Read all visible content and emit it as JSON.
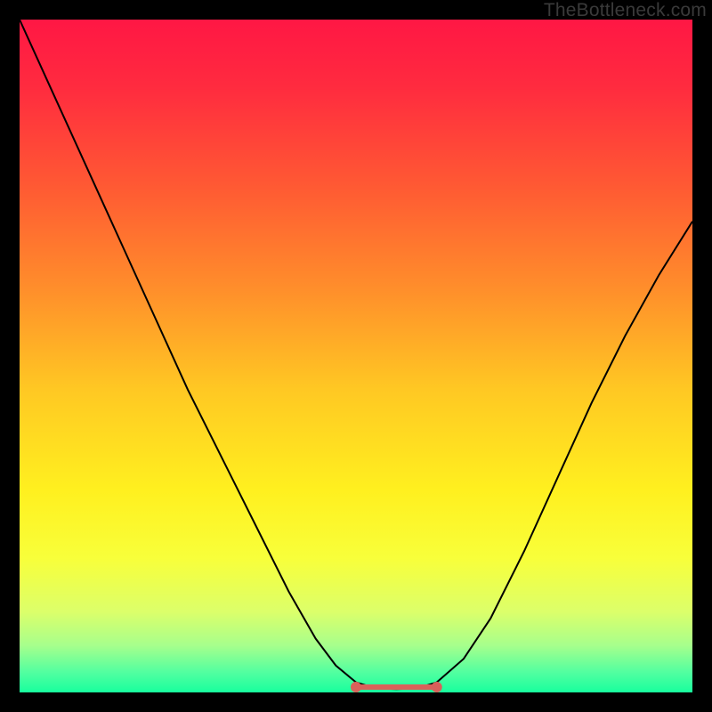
{
  "watermark": "TheBottleneck.com",
  "chart_data": {
    "type": "line",
    "title": "",
    "xlabel": "",
    "ylabel": "",
    "xlim": [
      0,
      100
    ],
    "ylim": [
      0,
      100
    ],
    "grid": false,
    "legend": false,
    "background_gradient": {
      "stops": [
        {
          "offset": 0.0,
          "color": "#ff1744"
        },
        {
          "offset": 0.1,
          "color": "#ff2b3f"
        },
        {
          "offset": 0.25,
          "color": "#ff5a33"
        },
        {
          "offset": 0.4,
          "color": "#ff8e2b"
        },
        {
          "offset": 0.55,
          "color": "#ffc823"
        },
        {
          "offset": 0.7,
          "color": "#fff01f"
        },
        {
          "offset": 0.8,
          "color": "#f8ff3a"
        },
        {
          "offset": 0.88,
          "color": "#dcff6a"
        },
        {
          "offset": 0.93,
          "color": "#a7ff8c"
        },
        {
          "offset": 0.97,
          "color": "#52ffa0"
        },
        {
          "offset": 1.0,
          "color": "#18ff9e"
        }
      ]
    },
    "series": [
      {
        "name": "bottleneck-curve",
        "color": "#000000",
        "x": [
          0,
          5,
          10,
          15,
          20,
          25,
          30,
          35,
          40,
          44,
          47,
          50,
          53,
          56,
          59,
          62,
          66,
          70,
          75,
          80,
          85,
          90,
          95,
          100
        ],
        "values": [
          100,
          89,
          78,
          67,
          56,
          45,
          35,
          25,
          15,
          8,
          4,
          1.5,
          0.6,
          0.5,
          0.6,
          1.5,
          5,
          11,
          21,
          32,
          43,
          53,
          62,
          70
        ]
      }
    ],
    "annotations": [
      {
        "name": "optimal-range-marker",
        "type": "segment",
        "color": "#d9605a",
        "x": [
          50,
          62
        ],
        "y": [
          0.8,
          0.8
        ],
        "endpoints": true
      }
    ]
  }
}
